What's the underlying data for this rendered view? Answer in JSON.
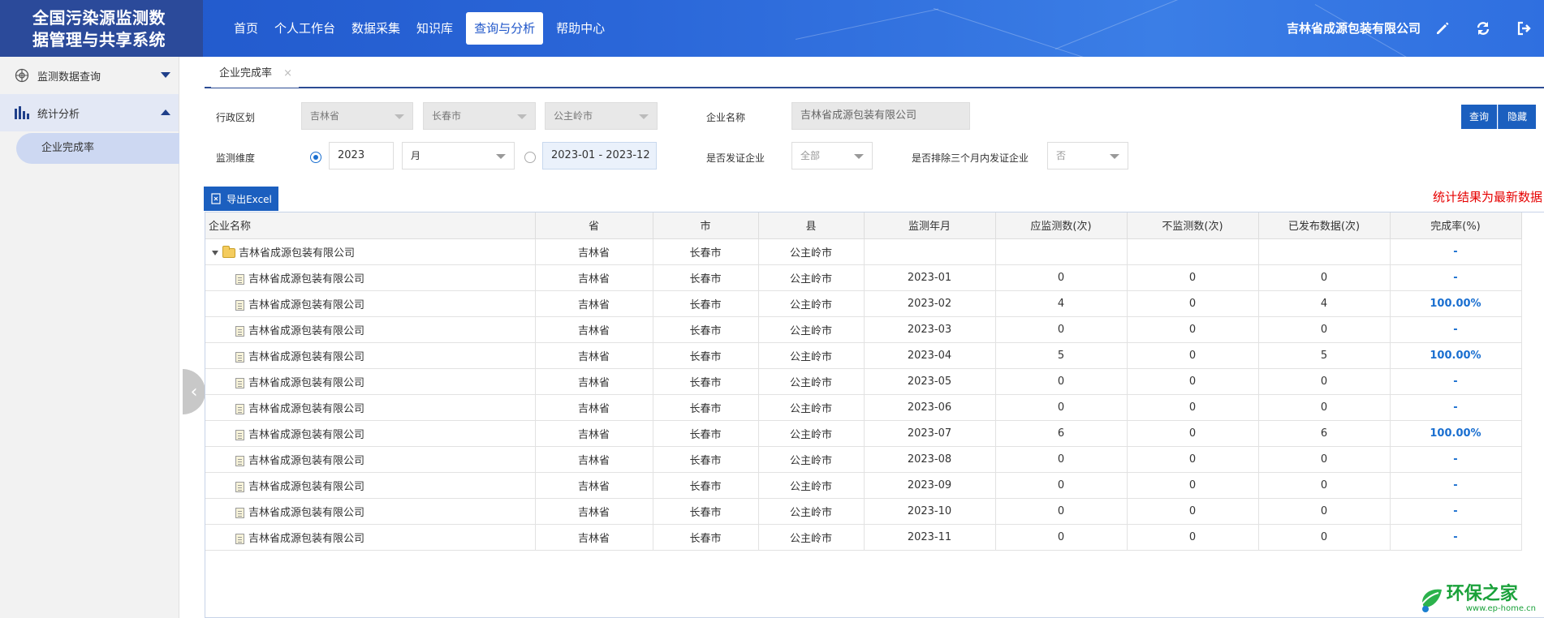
{
  "header": {
    "app_title_line1": "全国污染源监测数",
    "app_title_line2": "据管理与共享系统",
    "nav": [
      {
        "label": "首页"
      },
      {
        "label": "个人工作台"
      },
      {
        "label": "数据采集"
      },
      {
        "label": "知识库"
      },
      {
        "label": "查询与分析",
        "active": true
      },
      {
        "label": "帮助中心"
      }
    ],
    "company": "吉林省成源包装有限公司",
    "icons": [
      "edit-icon",
      "refresh-icon",
      "logout-icon"
    ]
  },
  "sidebar": {
    "items": [
      {
        "label": "监测数据查询",
        "icon": "monitor-icon",
        "expanded": false
      },
      {
        "label": "统计分析",
        "icon": "bar-chart-icon",
        "expanded": true
      }
    ],
    "sub_items": [
      {
        "label": "企业完成率",
        "active": true
      }
    ]
  },
  "tabs": [
    {
      "label": "企业完成率",
      "close": "×"
    }
  ],
  "filters": {
    "region_label": "行政区划",
    "province": "吉林省",
    "city": "长春市",
    "county": "公主岭市",
    "company_label": "企业名称",
    "company_value": "吉林省成源包装有限公司",
    "dimension_label": "监测维度",
    "year_value": "2023",
    "period_unit": "月",
    "date_range": "2023-01 - 2023-12",
    "certified_label": "是否发证企业",
    "certified_value": "全部",
    "exclude_label": "是否排除三个月内发证企业",
    "exclude_value": "否",
    "query_button": "查询",
    "hide_button": "隐藏"
  },
  "toolbar": {
    "export_label": "导出Excel",
    "notice": "统计结果为最新数据"
  },
  "table": {
    "headers": [
      "企业名称",
      "省",
      "市",
      "县",
      "监测年月",
      "应监测数(次)",
      "不监测数(次)",
      "已发布数据(次)",
      "完成率(%)"
    ],
    "parent": {
      "name": "吉林省成源包装有限公司",
      "province": "吉林省",
      "city": "长春市",
      "county": "公主岭市",
      "month": "",
      "expected": "",
      "not_monitored": "",
      "published": "",
      "rate": "-"
    },
    "rows": [
      {
        "name": "吉林省成源包装有限公司",
        "province": "吉林省",
        "city": "长春市",
        "county": "公主岭市",
        "month": "2023-01",
        "expected": "0",
        "not_monitored": "0",
        "published": "0",
        "rate": "-"
      },
      {
        "name": "吉林省成源包装有限公司",
        "province": "吉林省",
        "city": "长春市",
        "county": "公主岭市",
        "month": "2023-02",
        "expected": "4",
        "not_monitored": "0",
        "published": "4",
        "rate": "100.00%"
      },
      {
        "name": "吉林省成源包装有限公司",
        "province": "吉林省",
        "city": "长春市",
        "county": "公主岭市",
        "month": "2023-03",
        "expected": "0",
        "not_monitored": "0",
        "published": "0",
        "rate": "-"
      },
      {
        "name": "吉林省成源包装有限公司",
        "province": "吉林省",
        "city": "长春市",
        "county": "公主岭市",
        "month": "2023-04",
        "expected": "5",
        "not_monitored": "0",
        "published": "5",
        "rate": "100.00%"
      },
      {
        "name": "吉林省成源包装有限公司",
        "province": "吉林省",
        "city": "长春市",
        "county": "公主岭市",
        "month": "2023-05",
        "expected": "0",
        "not_monitored": "0",
        "published": "0",
        "rate": "-"
      },
      {
        "name": "吉林省成源包装有限公司",
        "province": "吉林省",
        "city": "长春市",
        "county": "公主岭市",
        "month": "2023-06",
        "expected": "0",
        "not_monitored": "0",
        "published": "0",
        "rate": "-"
      },
      {
        "name": "吉林省成源包装有限公司",
        "province": "吉林省",
        "city": "长春市",
        "county": "公主岭市",
        "month": "2023-07",
        "expected": "6",
        "not_monitored": "0",
        "published": "6",
        "rate": "100.00%"
      },
      {
        "name": "吉林省成源包装有限公司",
        "province": "吉林省",
        "city": "长春市",
        "county": "公主岭市",
        "month": "2023-08",
        "expected": "0",
        "not_monitored": "0",
        "published": "0",
        "rate": "-"
      },
      {
        "name": "吉林省成源包装有限公司",
        "province": "吉林省",
        "city": "长春市",
        "county": "公主岭市",
        "month": "2023-09",
        "expected": "0",
        "not_monitored": "0",
        "published": "0",
        "rate": "-"
      },
      {
        "name": "吉林省成源包装有限公司",
        "province": "吉林省",
        "city": "长春市",
        "county": "公主岭市",
        "month": "2023-10",
        "expected": "0",
        "not_monitored": "0",
        "published": "0",
        "rate": "-"
      },
      {
        "name": "吉林省成源包装有限公司",
        "province": "吉林省",
        "city": "长春市",
        "county": "公主岭市",
        "month": "2023-11",
        "expected": "0",
        "not_monitored": "0",
        "published": "0",
        "rate": "-"
      }
    ]
  },
  "watermark": {
    "main": "环保之家",
    "sub": "www.ep-home.cn"
  },
  "colors": {
    "primary": "#1b5fbf",
    "header_bg": "#2a66d8",
    "logo_bg": "#2b4a9a",
    "notice": "#e60000",
    "rate": "#1a6fd0"
  }
}
